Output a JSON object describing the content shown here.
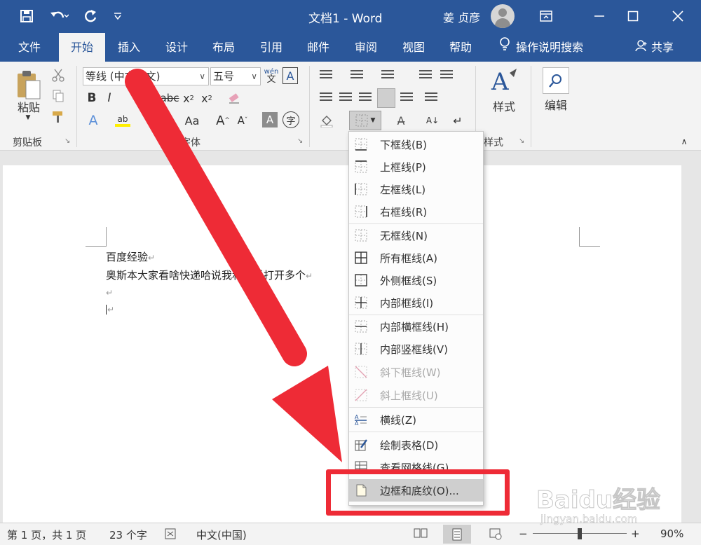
{
  "titlebar": {
    "title": "文档1  -  Word",
    "user": "姜 贞彦",
    "icons": [
      "save-icon",
      "undo-icon",
      "redo-icon",
      "customize-qat-icon",
      "ribbon-display-icon",
      "minimize-icon",
      "maximize-icon",
      "close-icon"
    ]
  },
  "tabs": [
    {
      "label": "文件",
      "active": false
    },
    {
      "label": "开始",
      "active": true
    },
    {
      "label": "插入",
      "active": false
    },
    {
      "label": "设计",
      "active": false
    },
    {
      "label": "布局",
      "active": false
    },
    {
      "label": "引用",
      "active": false
    },
    {
      "label": "邮件",
      "active": false
    },
    {
      "label": "审阅",
      "active": false
    },
    {
      "label": "视图",
      "active": false
    },
    {
      "label": "帮助",
      "active": false
    }
  ],
  "tell_me": "操作说明搜索",
  "share": "共享",
  "ribbon": {
    "clipboard": {
      "paste": "粘贴",
      "group": "剪贴板"
    },
    "font": {
      "name": "等线 (中文正文)",
      "size": "五号",
      "group": "字体",
      "phonetic": "wén",
      "phonetic_char": "文",
      "border_char": "A",
      "change_case": "Aa"
    },
    "styles": {
      "label": "样式",
      "group": "样式"
    },
    "editing": {
      "label": "编辑"
    }
  },
  "document": {
    "lines": [
      "百度经验",
      "奥斯本大家看啥快递哈说我和我说打开多个"
    ]
  },
  "border_menu": {
    "items": [
      {
        "label": "下框线(B)",
        "type": "bottom",
        "disabled": false
      },
      {
        "label": "上框线(P)",
        "type": "top",
        "disabled": false
      },
      {
        "label": "左框线(L)",
        "type": "left",
        "disabled": false
      },
      {
        "label": "右框线(R)",
        "type": "right",
        "disabled": false
      },
      {
        "label": "无框线(N)",
        "type": "none",
        "disabled": false
      },
      {
        "label": "所有框线(A)",
        "type": "all",
        "disabled": false
      },
      {
        "label": "外侧框线(S)",
        "type": "outside",
        "disabled": false
      },
      {
        "label": "内部框线(I)",
        "type": "inside",
        "disabled": false
      },
      {
        "label": "内部横框线(H)",
        "type": "inside-h",
        "disabled": false
      },
      {
        "label": "内部竖框线(V)",
        "type": "inside-v",
        "disabled": false
      },
      {
        "label": "斜下框线(W)",
        "type": "diag-down",
        "disabled": true
      },
      {
        "label": "斜上框线(U)",
        "type": "diag-up",
        "disabled": true
      },
      {
        "label": "横线(Z)",
        "type": "hline",
        "disabled": false
      },
      {
        "label": "绘制表格(D)",
        "type": "draw",
        "disabled": false
      },
      {
        "label": "查看网格线(G)",
        "type": "grid",
        "disabled": false
      },
      {
        "label": "边框和底纹(O)...",
        "type": "shading",
        "disabled": false,
        "highlighted": true
      }
    ]
  },
  "statusbar": {
    "page": "第 1 页，共 1 页",
    "words": "23 个字",
    "language": "中文(中国)",
    "zoom": "90%",
    "zoom_minus": "−",
    "zoom_plus": "+",
    "zoom_fraction": 0.5
  },
  "watermark": {
    "text": "Baidu经验",
    "url": "jingyan.baidu.com"
  },
  "colors": {
    "word_blue": "#2b579a",
    "annotation_red": "#ee2b36"
  }
}
